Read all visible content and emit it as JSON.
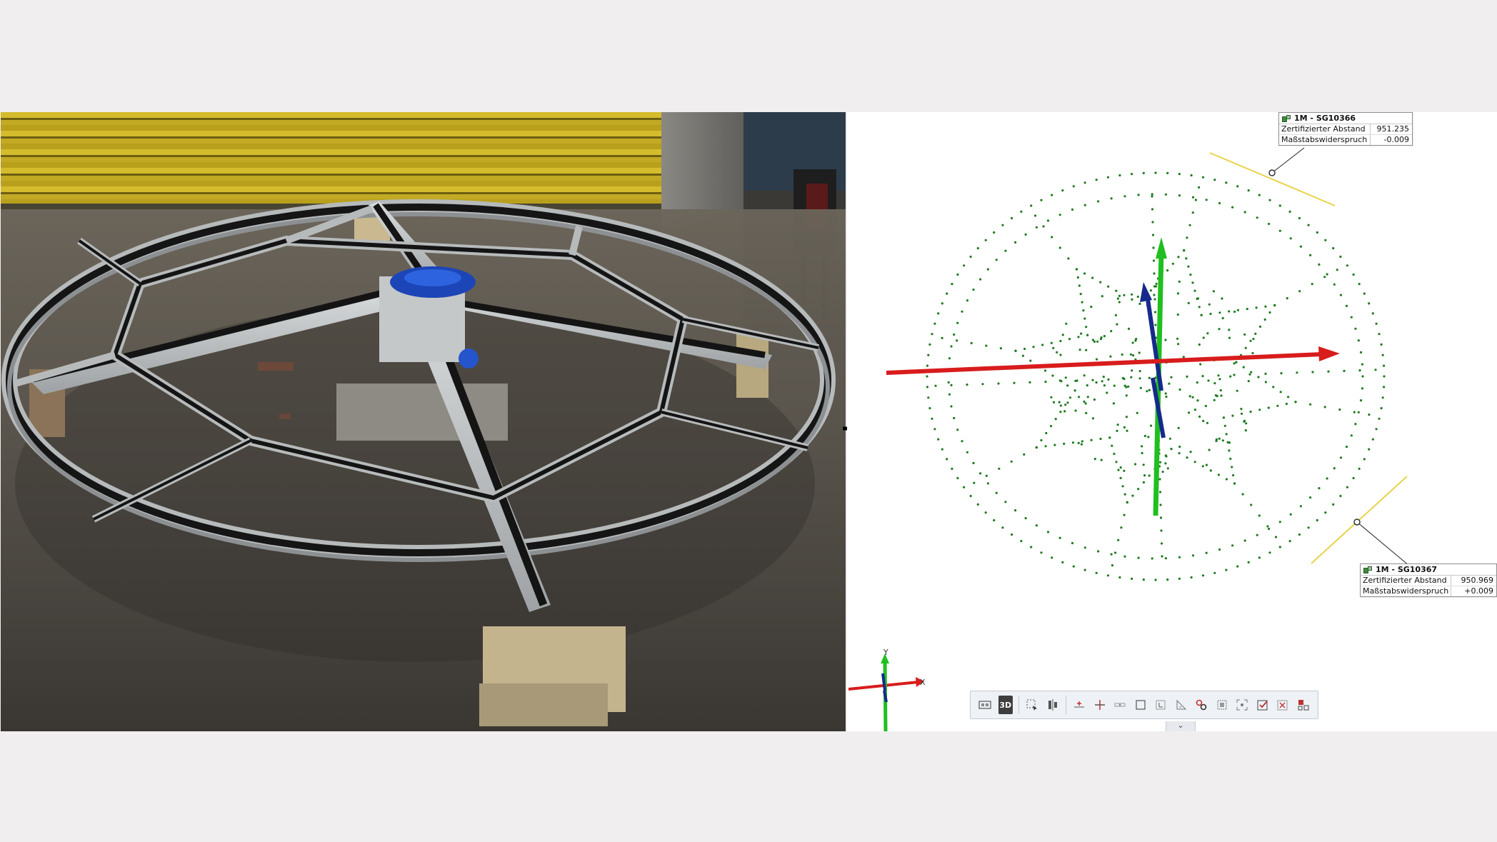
{
  "tags": [
    {
      "title": "1M - SG10366",
      "rows": [
        {
          "key": "Zertifizierter Abstand",
          "value": "951.235"
        },
        {
          "key": "Maßstabswiderspruch",
          "value": "-0.009"
        }
      ]
    },
    {
      "title": "1M - SG10367",
      "rows": [
        {
          "key": "Zertifizierter Abstand",
          "value": "950.969"
        },
        {
          "key": "Maßstabswiderspruch",
          "value": "+0.009"
        }
      ]
    }
  ],
  "axes": {
    "x_label": "X",
    "y_label": "Y"
  },
  "toolbar": {
    "button_3d_label": "3D",
    "expand_glyph": "⌄",
    "icons": [
      "display-mode-icon",
      "view-3d-icon",
      "select-box-icon",
      "align-icon",
      "add-point-icon",
      "move-point-icon",
      "scale-bar-icon",
      "frame-icon",
      "coordinate-icon",
      "angle-icon",
      "link-icon",
      "fit-icon",
      "zoom-extents-icon",
      "check-icon",
      "clear-icon",
      "settings-icon"
    ]
  },
  "colors": {
    "x_axis": "#d81c1c",
    "y_axis": "#1fbf1f",
    "z_axis": "#152a8a",
    "points": "#1f7a1f",
    "scale_bar": "#e8d24a",
    "accent_red": "#c03030"
  }
}
